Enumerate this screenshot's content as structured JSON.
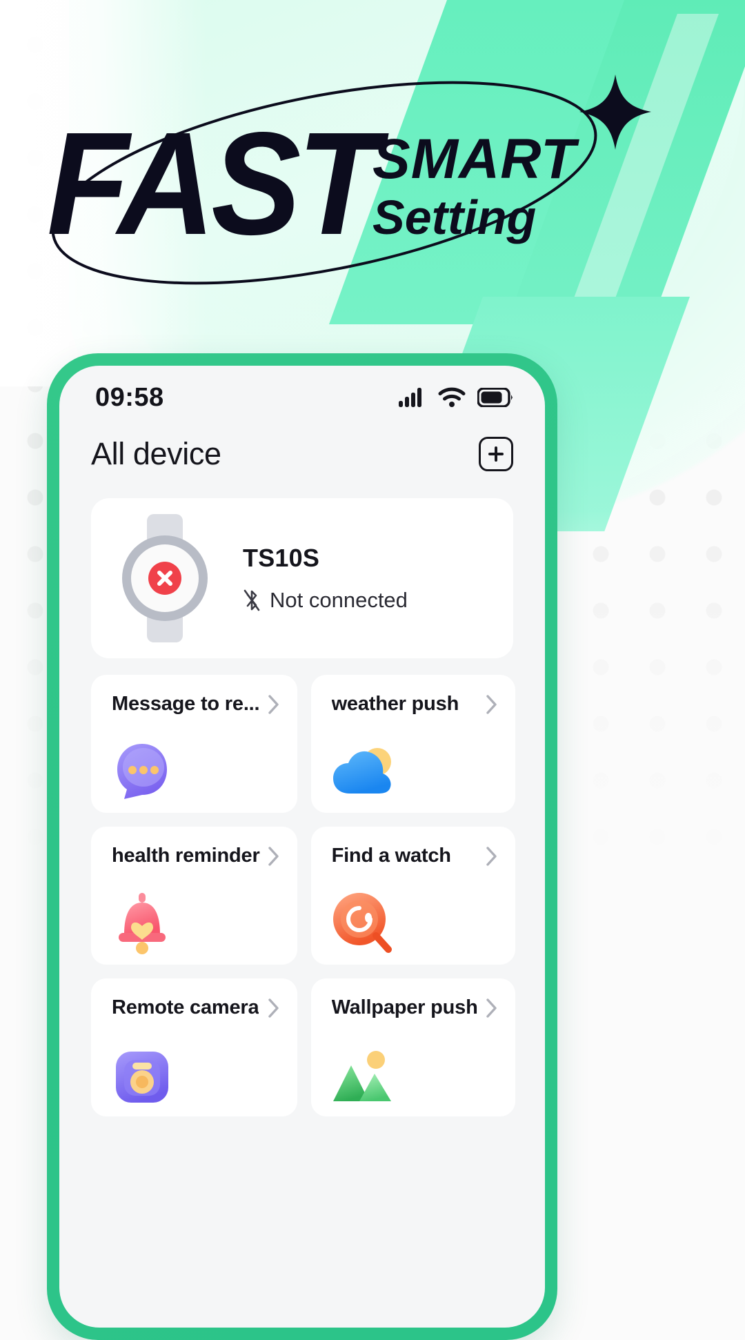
{
  "banner": {
    "headline_main": "FAST",
    "headline_sub1": "SMART",
    "headline_sub2": "Setting",
    "sparkle_icon": "four-point-star-icon",
    "orbit_icon": "orbit-ellipse-icon",
    "accent_color": "#2cc489",
    "mint_color": "#6ef0c0",
    "headline_color": "#0c0c1d"
  },
  "phone": {
    "frame_color": "#2cc489",
    "status_bar": {
      "time": "09:58",
      "signal_icon": "cellular-signal-icon",
      "wifi_icon": "wifi-icon",
      "battery_icon": "battery-icon",
      "battery_level": 75
    },
    "header": {
      "title": "All device",
      "add_label": "+",
      "add_icon": "plus-square-icon"
    },
    "device_card": {
      "name": "TS10S",
      "status": "Not connected",
      "status_icon": "bluetooth-off-icon",
      "device_icon": "smartwatch-icon",
      "badge_icon": "error-x-icon",
      "badge_color": "#f0414a"
    },
    "features": [
      {
        "label": "Message to re...",
        "icon": "chat-bubble-icon",
        "chevron": "chevron-right-icon",
        "color": "#8b7bf2"
      },
      {
        "label": "weather push",
        "icon": "cloud-sun-icon",
        "chevron": "chevron-right-icon",
        "color": "#2f9dfa"
      },
      {
        "label": "health reminder",
        "icon": "bell-heart-icon",
        "chevron": "chevron-right-icon",
        "color": "#fb6f7e"
      },
      {
        "label": "Find a watch",
        "icon": "find-watch-icon",
        "chevron": "chevron-right-icon",
        "color": "#f76a3c"
      },
      {
        "label": "Remote camera",
        "icon": "camera-icon",
        "chevron": "chevron-right-icon",
        "color": "#7b6ef0"
      },
      {
        "label": "Wallpaper push",
        "icon": "mountain-image-icon",
        "chevron": "chevron-right-icon",
        "color": "#3fc46a"
      }
    ]
  }
}
